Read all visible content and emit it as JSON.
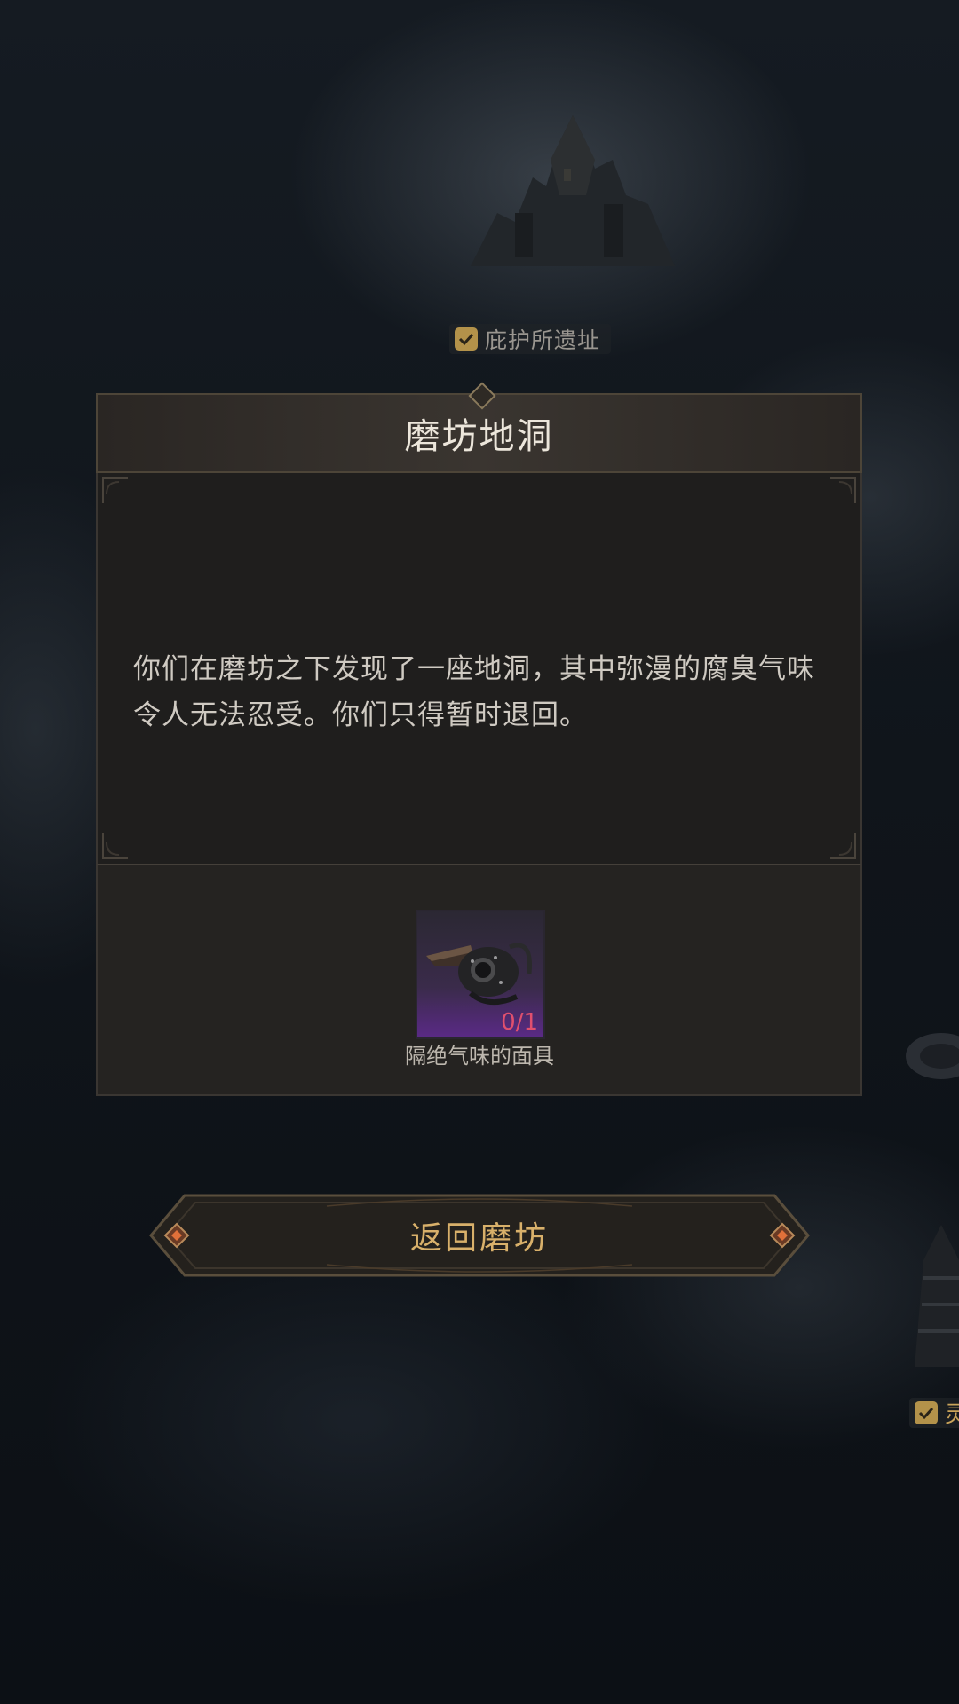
{
  "map": {
    "markers": [
      {
        "label": "庇护所遗址",
        "icon": "check-icon"
      },
      {
        "label": "灵",
        "icon": "check-icon"
      }
    ]
  },
  "dialog": {
    "title": "磨坊地洞",
    "body": "你们在磨坊之下发现了一座地洞，其中弥漫的腐臭气味令人无法忍受。你们只得暂时退回。",
    "required_item": {
      "icon": "plague-mask-icon",
      "count": "0/1",
      "name": "隔绝气味的面具"
    }
  },
  "actions": {
    "return_label": "返回磨坊"
  },
  "colors": {
    "accent_gold": "#d8b06a",
    "count_red": "#e0506e",
    "item_rarity_purple": "#5a2a86"
  }
}
